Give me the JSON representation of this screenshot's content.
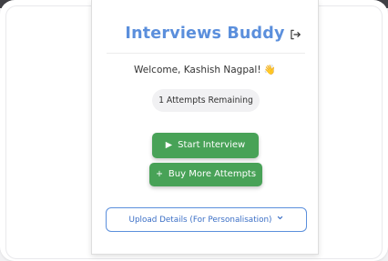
{
  "popup": {
    "title": "Interviews Buddy",
    "welcome": "Welcome, Kashish Nagpal! 👋",
    "attempts_text": "1 Attempts Remaining",
    "start_button": "Start Interview",
    "start_icon": "play-icon",
    "buy_button": "Buy More Attempts",
    "buy_icon": "plus-icon",
    "upload_button": "Upload Details (For Personalisation)",
    "upload_icon": "chevron-down-icon",
    "logout_icon": "logout-icon"
  },
  "colors": {
    "title": "#5b8fdc",
    "button_green": "#48a257",
    "outline_blue": "#5b8fdc",
    "topbar": "#3f3f44"
  }
}
